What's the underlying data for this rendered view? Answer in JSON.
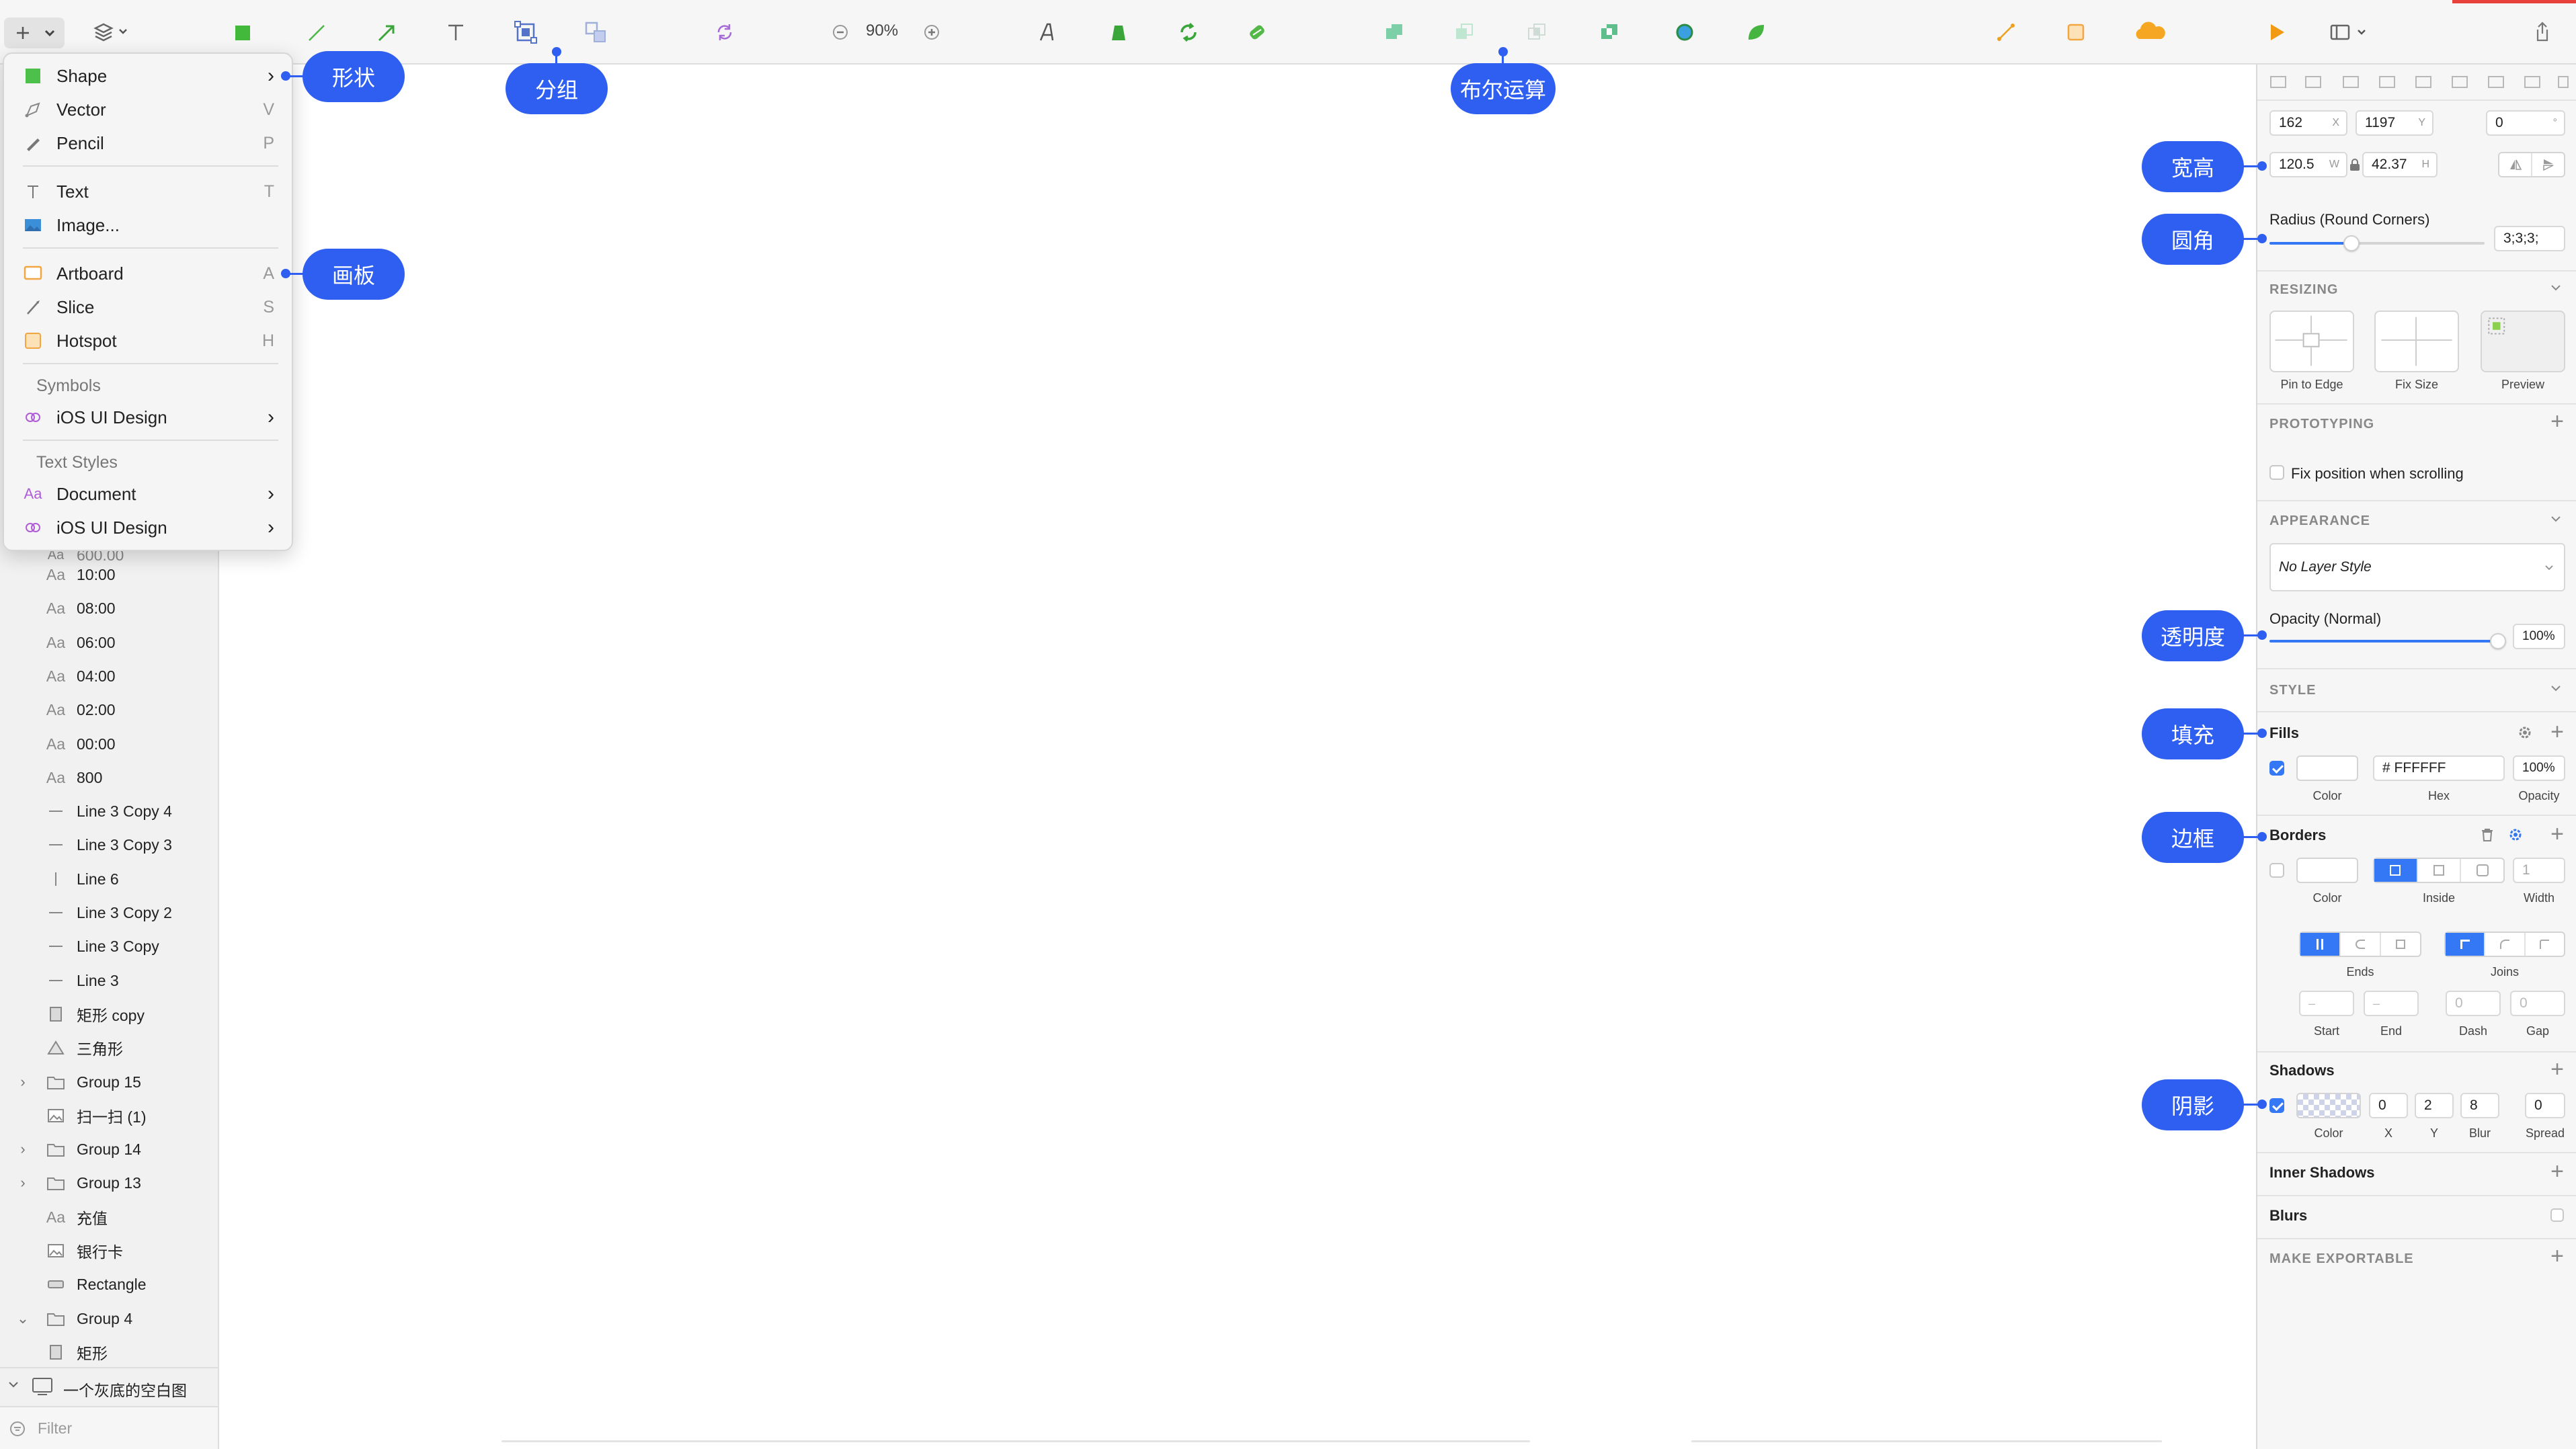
{
  "toolbar": {
    "zoom": "90%"
  },
  "insert_menu": {
    "items": [
      {
        "label": "Shape",
        "key": "",
        "arrow": "›"
      },
      {
        "label": "Vector",
        "key": "V"
      },
      {
        "label": "Pencil",
        "key": "P"
      },
      {
        "label": "Text",
        "key": "T"
      },
      {
        "label": "Image...",
        "key": ""
      },
      {
        "label": "Artboard",
        "key": "A"
      },
      {
        "label": "Slice",
        "key": "S"
      },
      {
        "label": "Hotspot",
        "key": "H"
      }
    ],
    "symbols_header": "Symbols",
    "symbols_item": "iOS UI Design",
    "text_styles_header": "Text Styles",
    "text_styles_items": [
      "Document",
      "iOS UI Design"
    ],
    "submenu_arrow": "›"
  },
  "layers": {
    "partial_row": "600.00",
    "rows": [
      {
        "icon": "Aa",
        "name": "10:00"
      },
      {
        "icon": "Aa",
        "name": "08:00"
      },
      {
        "icon": "Aa",
        "name": "06:00"
      },
      {
        "icon": "Aa",
        "name": "04:00"
      },
      {
        "icon": "Aa",
        "name": "02:00"
      },
      {
        "icon": "Aa",
        "name": "00:00"
      },
      {
        "icon": "Aa",
        "name": "800"
      },
      {
        "icon": "line",
        "name": "Line 3 Copy 4"
      },
      {
        "icon": "line",
        "name": "Line 3 Copy 3"
      },
      {
        "icon": "vline",
        "name": "Line 6"
      },
      {
        "icon": "line",
        "name": "Line 3 Copy 2"
      },
      {
        "icon": "line",
        "name": "Line 3 Copy"
      },
      {
        "icon": "line",
        "name": "Line 3"
      },
      {
        "icon": "rect",
        "name": "矩形 copy"
      },
      {
        "icon": "triangle",
        "name": "三角形"
      },
      {
        "icon": "folder",
        "name": "Group 15",
        "chev": "›"
      },
      {
        "icon": "image",
        "name": "扫一扫 (1)"
      },
      {
        "icon": "folder",
        "name": "Group 14",
        "chev": "›"
      },
      {
        "icon": "folder",
        "name": "Group 13",
        "chev": "›"
      },
      {
        "icon": "Aa",
        "name": "充值"
      },
      {
        "icon": "image",
        "name": "银行卡"
      },
      {
        "icon": "rect-wide",
        "name": "Rectangle"
      },
      {
        "icon": "folder",
        "name": "Group 4",
        "chev": "⌄"
      },
      {
        "icon": "rect",
        "name": "矩形"
      }
    ],
    "page_name": "一个灰底的空白图",
    "filter_placeholder": "Filter"
  },
  "inspector": {
    "x": "162",
    "x_unit": "X",
    "y": "1197",
    "y_unit": "Y",
    "rotation": "0",
    "rotation_unit": "°",
    "width": "120.5",
    "width_unit": "W",
    "height": "42.37",
    "height_unit": "H",
    "radius_label": "Radius (Round Corners)",
    "radius_value": "3;3;3;",
    "radius_slider": 0.38,
    "resizing_header": "RESIZING",
    "resizing_options": [
      "Pin to Edge",
      "Fix Size",
      "Preview"
    ],
    "prototyping_header": "PROTOTYPING",
    "fix_position_label": "Fix position when scrolling",
    "appearance_header": "APPEARANCE",
    "layer_style": "No Layer Style",
    "opacity_label": "Opacity (Normal)",
    "opacity_value": "100%",
    "opacity_slider": 1.0,
    "style_header": "STYLE",
    "fills": {
      "title": "Fills",
      "hex": "# FFFFFF",
      "opacity": "100%",
      "captions": [
        "Color",
        "Hex",
        "Opacity"
      ]
    },
    "borders": {
      "title": "Borders",
      "width": "1",
      "captions": [
        "Color",
        "Inside",
        "Width"
      ],
      "ends_label": "Ends",
      "joins_label": "Joins",
      "start_caption": "Start",
      "end_caption": "End",
      "dash_caption": "Dash",
      "gap_caption": "Gap",
      "dash_value": "0",
      "gap_value": "0"
    },
    "shadows": {
      "title": "Shadows",
      "x": "0",
      "y": "2",
      "blur": "8",
      "spread": "0",
      "captions": [
        "Color",
        "X",
        "Y",
        "Blur",
        "Spread"
      ]
    },
    "inner_shadows_title": "Inner Shadows",
    "blurs_title": "Blurs",
    "exportable_header": "MAKE EXPORTABLE"
  },
  "callouts": {
    "shape": "形状",
    "group": "分组",
    "boolean": "布尔运算",
    "artboard": "画板",
    "size": "宽高",
    "radius": "圆角",
    "opacity": "透明度",
    "fill": "填充",
    "border": "边框",
    "shadow": "阴影"
  },
  "colors": {
    "accent": "#3478f6",
    "callout": "#2f5ff0",
    "toolbar_red": "#e8403a"
  }
}
